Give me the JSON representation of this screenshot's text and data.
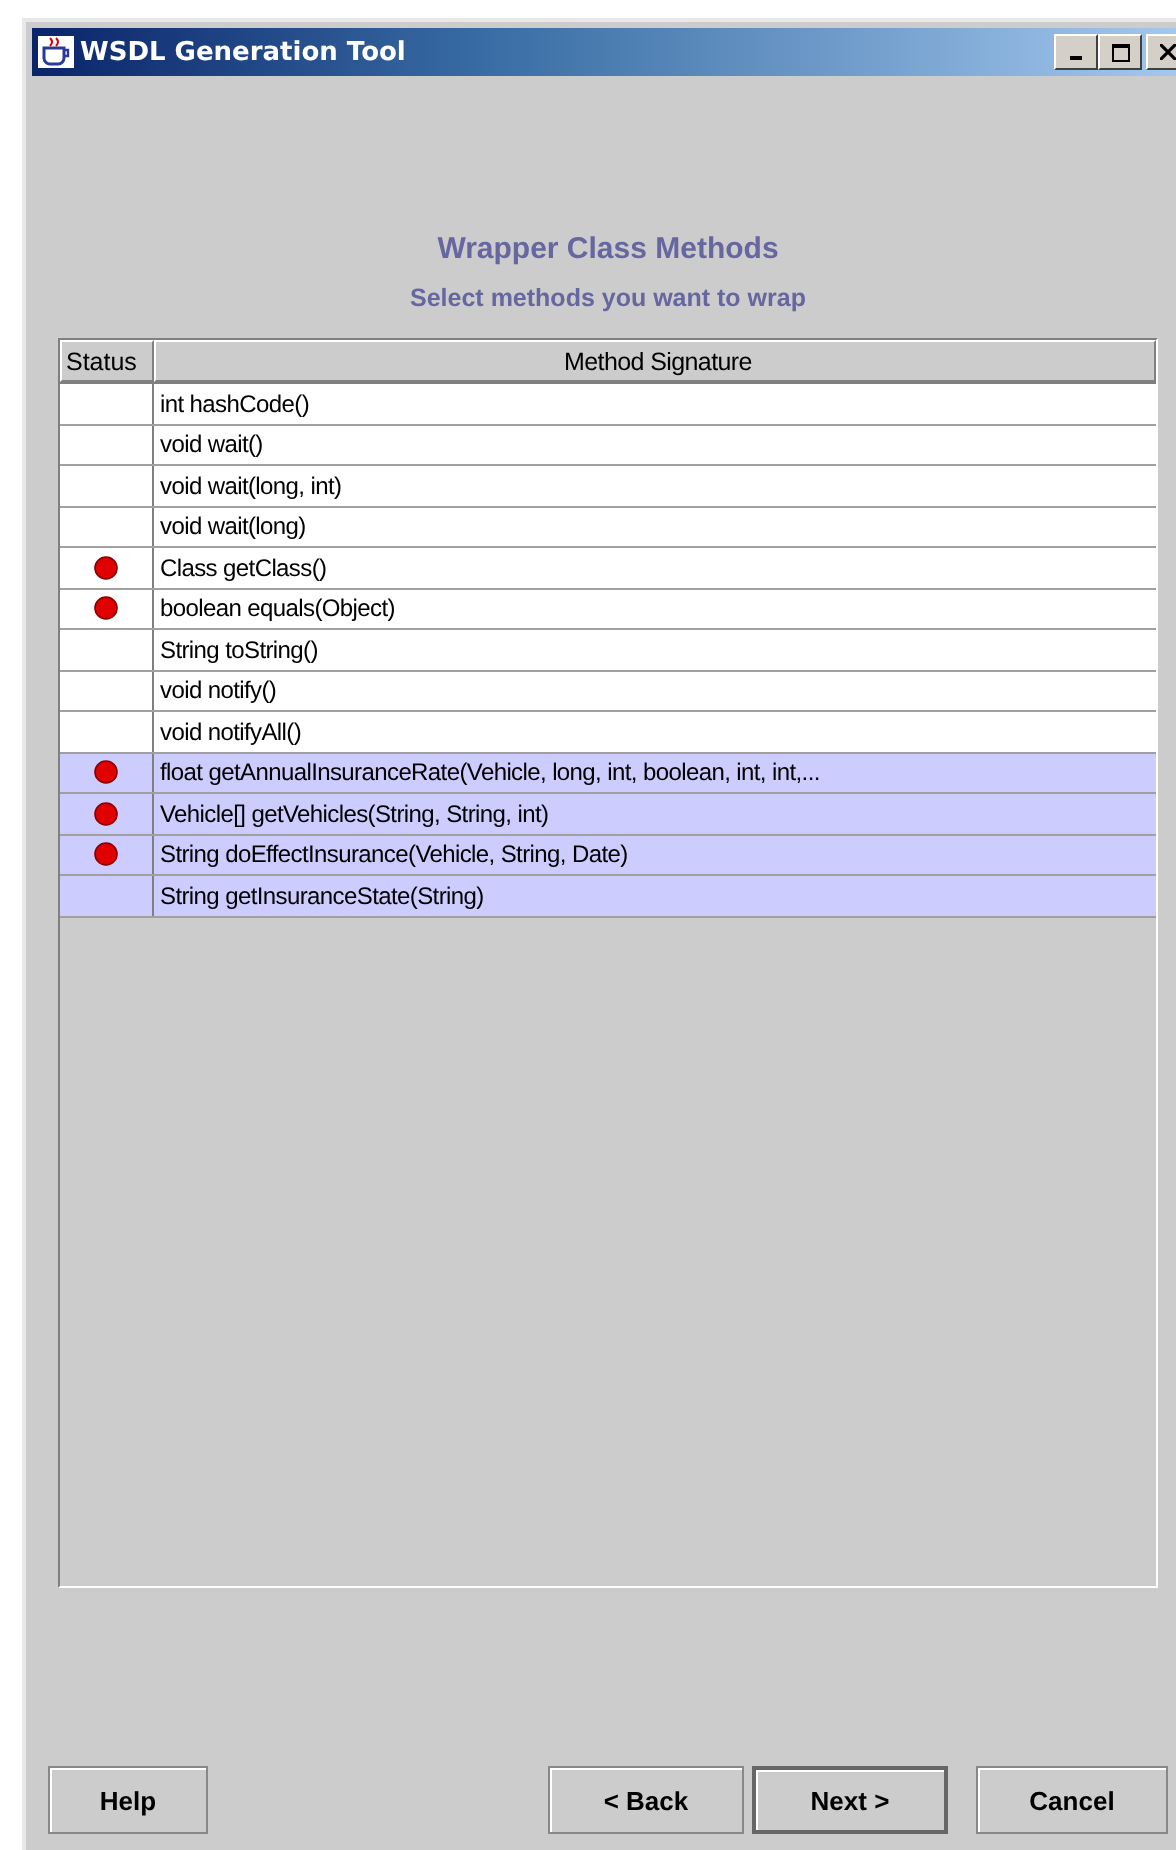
{
  "window": {
    "title": "WSDL Generation Tool"
  },
  "heading": "Wrapper Class Methods",
  "subheading": "Select methods you want to wrap",
  "table": {
    "columns": [
      "Status",
      "Method Signature"
    ],
    "rows": [
      {
        "signature": "int hashCode()",
        "marked": false,
        "selected": false
      },
      {
        "signature": "void wait()",
        "marked": false,
        "selected": false
      },
      {
        "signature": "void wait(long, int)",
        "marked": false,
        "selected": false
      },
      {
        "signature": "void wait(long)",
        "marked": false,
        "selected": false
      },
      {
        "signature": "Class getClass()",
        "marked": true,
        "selected": false
      },
      {
        "signature": "boolean equals(Object)",
        "marked": true,
        "selected": false
      },
      {
        "signature": "String toString()",
        "marked": false,
        "selected": false
      },
      {
        "signature": "void notify()",
        "marked": false,
        "selected": false
      },
      {
        "signature": "void notifyAll()",
        "marked": false,
        "selected": false
      },
      {
        "signature": "float getAnnualInsuranceRate(Vehicle, long, int, boolean, int, int,...",
        "marked": true,
        "selected": true
      },
      {
        "signature": "Vehicle[] getVehicles(String, String, int)",
        "marked": true,
        "selected": true
      },
      {
        "signature": "String doEffectInsurance(Vehicle, String, Date)",
        "marked": true,
        "selected": true
      },
      {
        "signature": "String getInsuranceState(String)",
        "marked": false,
        "selected": true
      }
    ]
  },
  "buttons": {
    "left": [
      "Help"
    ],
    "right": [
      "< Back",
      "Next >",
      "Cancel"
    ]
  }
}
